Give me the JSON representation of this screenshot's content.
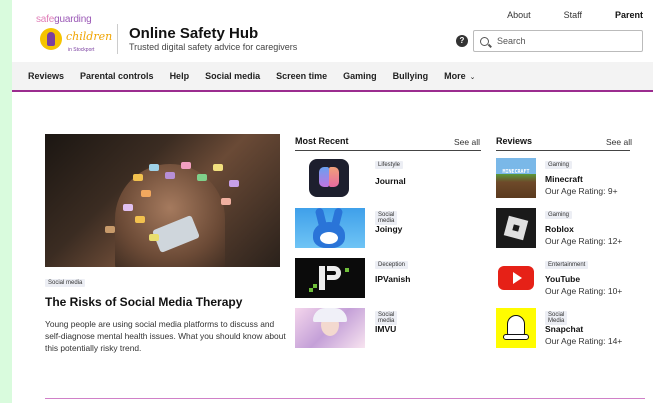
{
  "top_links": [
    "About",
    "Staff",
    "Parent"
  ],
  "logo": {
    "line1a": "safe",
    "line1b": "guarding",
    "script": "children",
    "small": "in Stockport"
  },
  "site": {
    "title": "Online Safety Hub",
    "subtitle": "Trusted digital safety advice for caregivers"
  },
  "search": {
    "placeholder": "Search",
    "help": "?"
  },
  "nav": [
    "Reviews",
    "Parental controls",
    "Help",
    "Social media",
    "Screen time",
    "Gaming",
    "Bullying",
    "More"
  ],
  "nav_more_chevron": "⌄",
  "feature": {
    "tag": "Social media",
    "title": "The Risks of Social Media Therapy",
    "description": "Young people are using social media platforms to discuss and self-diagnose mental health issues. What you should know about this potentially risky trend."
  },
  "most_recent": {
    "heading": "Most Recent",
    "see_all": "See all",
    "items": [
      {
        "tag": "Lifestyle",
        "title": "Journal",
        "icon": "journal-app-icon"
      },
      {
        "tag": "Social media",
        "title": "Joingy",
        "icon": "joingy-bunny-icon"
      },
      {
        "tag": "Deception",
        "title": "IPVanish",
        "icon": "ipvanish-icon"
      },
      {
        "tag": "Social media",
        "title": "IMVU",
        "icon": "imvu-avatar-icon"
      }
    ]
  },
  "reviews": {
    "heading": "Reviews",
    "see_all": "See all",
    "items": [
      {
        "tag": "Gaming",
        "title": "Minecraft",
        "rating": "Our Age Rating: 9+",
        "icon": "minecraft-icon",
        "thumb_text": "MINECRAFT"
      },
      {
        "tag": "Gaming",
        "title": "Roblox",
        "rating": "Our Age Rating: 12+",
        "icon": "roblox-icon"
      },
      {
        "tag": "Entertainment",
        "title": "YouTube",
        "rating": "Our Age Rating: 10+",
        "icon": "youtube-icon"
      },
      {
        "tag": "Social Media",
        "title": "Snapchat",
        "rating": "Our Age Rating: 14+",
        "icon": "snapchat-icon"
      }
    ]
  },
  "colors": {
    "accent": "#9b2c8f",
    "page_bg": "#d9fbdd",
    "youtube": "#e62117",
    "snapchat": "#fffc00"
  }
}
